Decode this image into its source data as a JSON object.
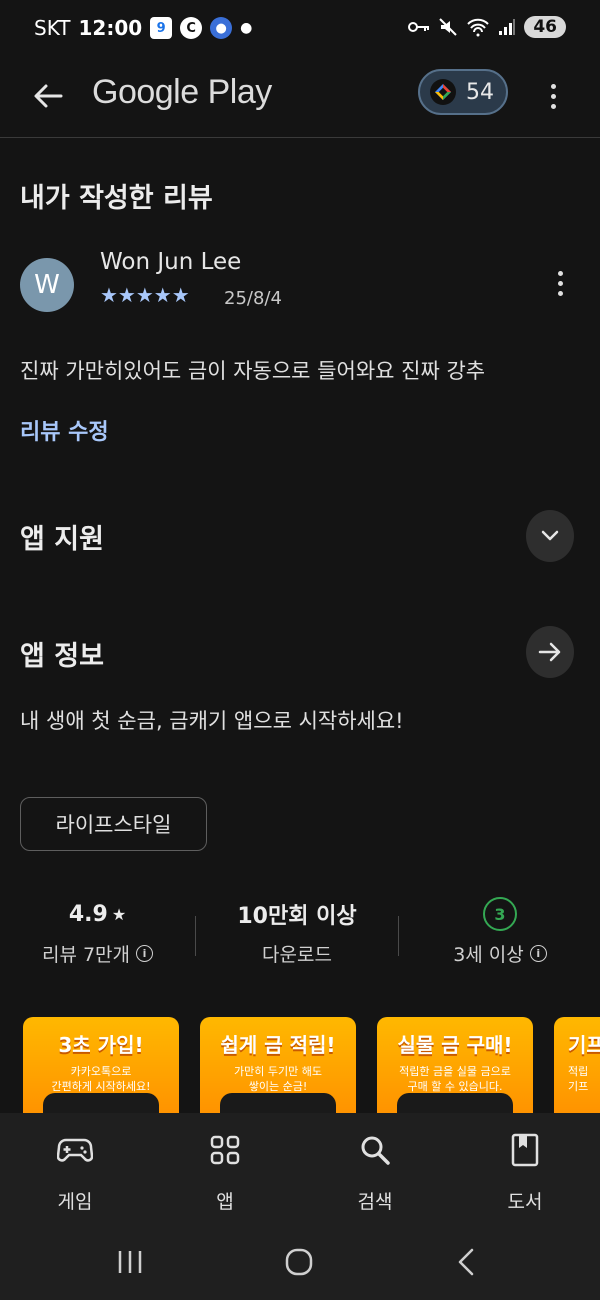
{
  "status_bar": {
    "carrier": "SKT",
    "time": "12:00",
    "battery": "46"
  },
  "app_bar": {
    "title": "Google Play",
    "points": "54"
  },
  "my_review": {
    "heading": "내가 작성한 리뷰",
    "avatar_letter": "W",
    "reviewer_name": "Won Jun Lee",
    "rating": 5,
    "stars": "★★★★★",
    "date": "25/8/4",
    "text": "진짜 가만히있어도 금이 자동으로 들어와요 진짜 강추",
    "edit_label": "리뷰 수정"
  },
  "app_support": {
    "heading": "앱 지원"
  },
  "app_info": {
    "heading": "앱 정보",
    "description": "내 생애 첫 순금, 금캐기 앱으로 시작하세요!",
    "category_chip": "라이프스타일"
  },
  "stats": [
    {
      "value": "4.9",
      "label": "리뷰 7만개"
    },
    {
      "value": "10만회 이상",
      "label": "다운로드"
    },
    {
      "value": "3",
      "label": "3세 이상"
    }
  ],
  "screenshots": [
    {
      "title": "3초 가입!",
      "subtitle": "카카오톡으로\n간편하게 시작하세요!"
    },
    {
      "title": "쉽게 금 적립!",
      "subtitle": "가만히 두기만 해도\n쌓이는 순금!"
    },
    {
      "title": "실물 금 구매!",
      "subtitle": "적립한 금을 실물 금으로\n구매 할 수 있습니다."
    },
    {
      "title": "기프",
      "subtitle": "적립\n기프"
    }
  ],
  "bottom_nav": [
    {
      "label": "게임",
      "icon": "gamepad-icon"
    },
    {
      "label": "앱",
      "icon": "apps-grid-icon"
    },
    {
      "label": "검색",
      "icon": "search-icon"
    },
    {
      "label": "도서",
      "icon": "book-icon"
    }
  ],
  "colors": {
    "accent": "#a8c7fa",
    "background": "#141414",
    "age_badge": "#34a853",
    "screenshot_orange": "#ff9800"
  }
}
